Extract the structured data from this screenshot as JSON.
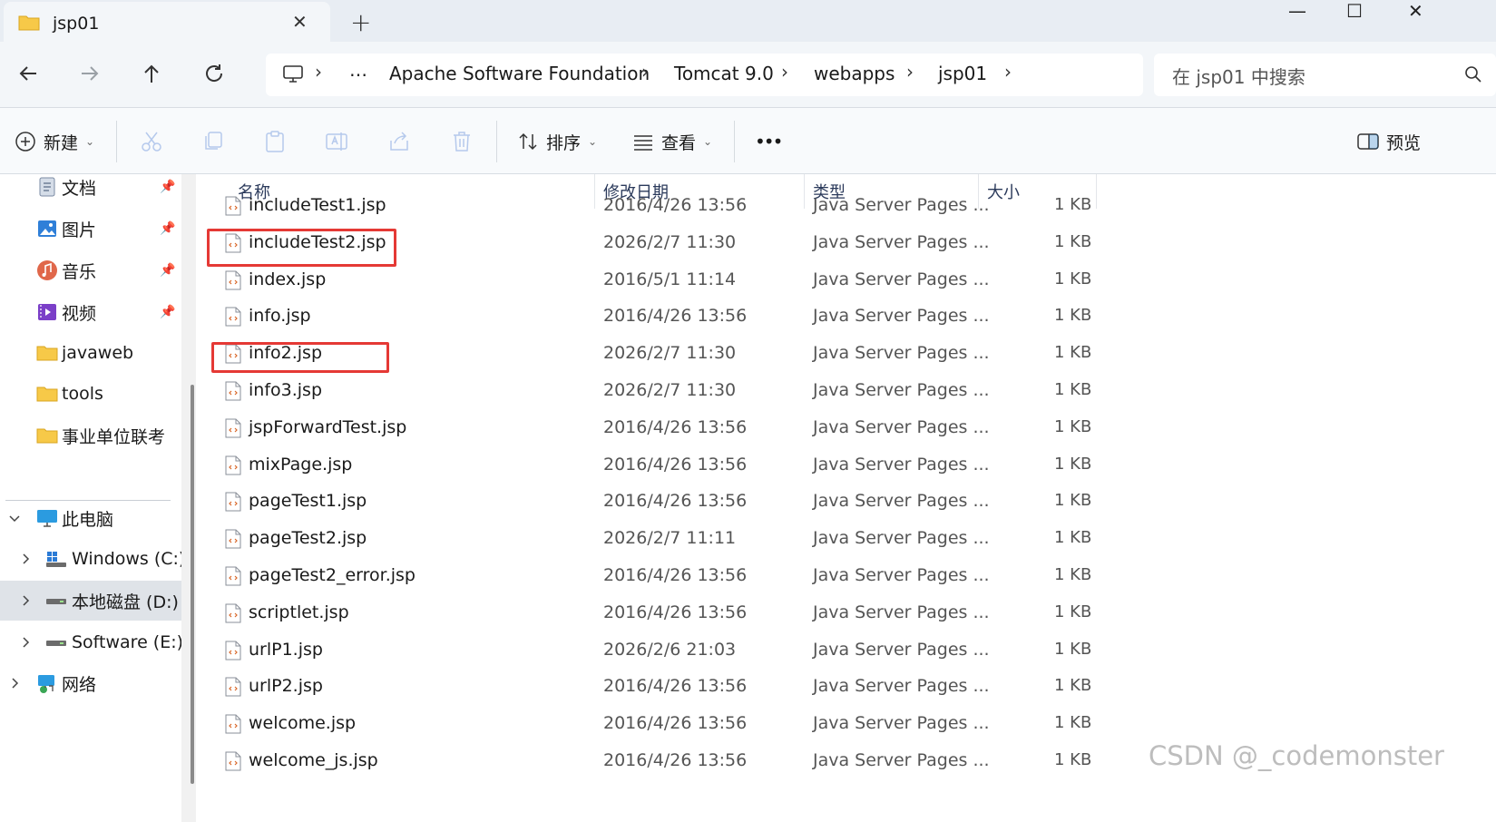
{
  "window": {
    "tab_title": "jsp01",
    "tab_close": "✕",
    "new_tab": "+",
    "minimize": "—",
    "maximize": "☐",
    "close": "✕"
  },
  "address": {
    "crumbs": [
      "…",
      "Apache Software Foundation",
      "Tomcat 9.0",
      "webapps",
      "jsp01"
    ],
    "separator": "›",
    "search_placeholder": "在 jsp01 中搜索"
  },
  "commands": {
    "new_label": "新建",
    "sort_label": "排序",
    "view_label": "查看",
    "more_label": "•••",
    "preview_label": "预览",
    "caret": "⌄"
  },
  "sidebar": {
    "quick": [
      {
        "label": "文档",
        "icon": "document-icon",
        "pinned": true
      },
      {
        "label": "图片",
        "icon": "picture-icon",
        "pinned": true
      },
      {
        "label": "音乐",
        "icon": "music-icon",
        "pinned": true
      },
      {
        "label": "视频",
        "icon": "video-icon",
        "pinned": true
      },
      {
        "label": "javaweb",
        "icon": "folder-icon",
        "pinned": false
      },
      {
        "label": "tools",
        "icon": "folder-icon",
        "pinned": false
      },
      {
        "label": "事业单位联考",
        "icon": "folder-icon",
        "pinned": false
      }
    ],
    "this_pc": "此电脑",
    "drives": [
      {
        "label": "Windows (C:)",
        "selected": false
      },
      {
        "label": "本地磁盘 (D:)",
        "selected": true
      },
      {
        "label": "Software (E:)",
        "selected": false
      }
    ],
    "network": "网络",
    "pin_glyph": "📌"
  },
  "columns": {
    "name": "名称",
    "date": "修改日期",
    "type": "类型",
    "size": "大小"
  },
  "files": [
    {
      "name": "includeTest1.jsp",
      "date": "2016/4/26 13:56",
      "type": "Java Server Pages ...",
      "size": "1 KB"
    },
    {
      "name": "includeTest2.jsp",
      "date": "2026/2/7 11:30",
      "type": "Java Server Pages ...",
      "size": "1 KB",
      "highlighted": true
    },
    {
      "name": "index.jsp",
      "date": "2016/5/1 11:14",
      "type": "Java Server Pages ...",
      "size": "1 KB"
    },
    {
      "name": "info.jsp",
      "date": "2016/4/26 13:56",
      "type": "Java Server Pages ...",
      "size": "1 KB"
    },
    {
      "name": "info2.jsp",
      "date": "2026/2/7 11:30",
      "type": "Java Server Pages ...",
      "size": "1 KB",
      "highlighted": true
    },
    {
      "name": "info3.jsp",
      "date": "2026/2/7 11:30",
      "type": "Java Server Pages ...",
      "size": "1 KB"
    },
    {
      "name": "jspForwardTest.jsp",
      "date": "2016/4/26 13:56",
      "type": "Java Server Pages ...",
      "size": "1 KB"
    },
    {
      "name": "mixPage.jsp",
      "date": "2016/4/26 13:56",
      "type": "Java Server Pages ...",
      "size": "1 KB"
    },
    {
      "name": "pageTest1.jsp",
      "date": "2016/4/26 13:56",
      "type": "Java Server Pages ...",
      "size": "1 KB"
    },
    {
      "name": "pageTest2.jsp",
      "date": "2026/2/7 11:11",
      "type": "Java Server Pages ...",
      "size": "1 KB"
    },
    {
      "name": "pageTest2_error.jsp",
      "date": "2016/4/26 13:56",
      "type": "Java Server Pages ...",
      "size": "1 KB"
    },
    {
      "name": "scriptlet.jsp",
      "date": "2016/4/26 13:56",
      "type": "Java Server Pages ...",
      "size": "1 KB"
    },
    {
      "name": "urlP1.jsp",
      "date": "2026/2/6 21:03",
      "type": "Java Server Pages ...",
      "size": "1 KB"
    },
    {
      "name": "urlP2.jsp",
      "date": "2016/4/26 13:56",
      "type": "Java Server Pages ...",
      "size": "1 KB"
    },
    {
      "name": "welcome.jsp",
      "date": "2016/4/26 13:56",
      "type": "Java Server Pages ...",
      "size": "1 KB"
    },
    {
      "name": "welcome_js.jsp",
      "date": "2016/4/26 13:56",
      "type": "Java Server Pages ...",
      "size": "1 KB"
    }
  ],
  "colors": {
    "highlight": "#e53935",
    "accent": "#0067c0",
    "folder": "#f7c948"
  },
  "watermark": "CSDN @_codemonster"
}
